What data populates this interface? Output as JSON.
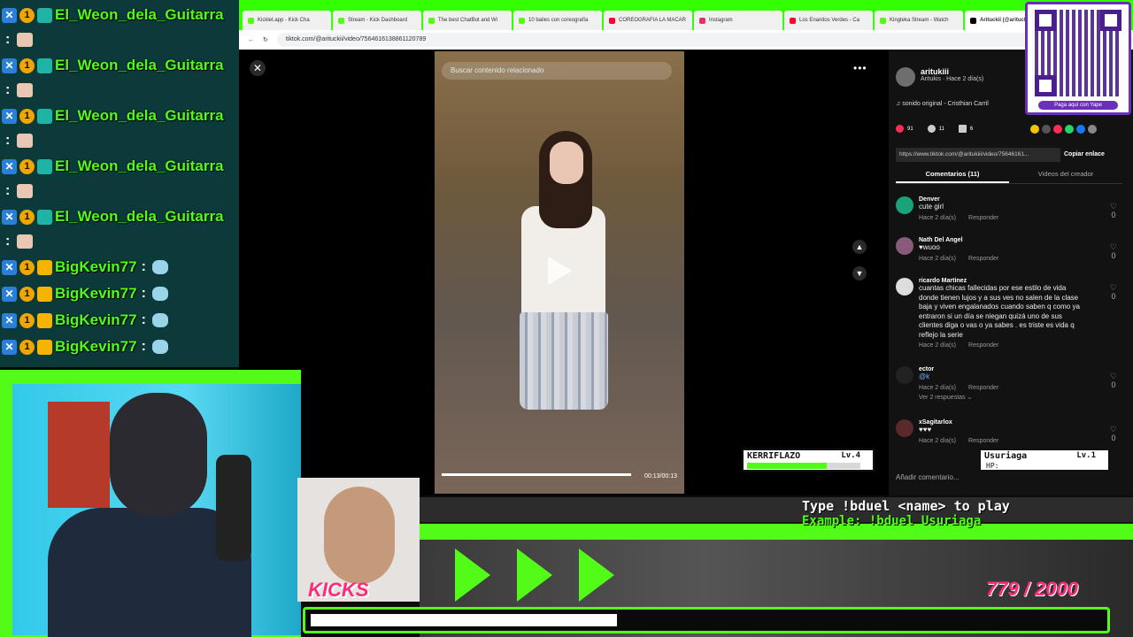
{
  "chat": {
    "messages": [
      {
        "user": "El_Weon_dela_Guitarra"
      },
      {
        "user": "El_Weon_dela_Guitarra"
      },
      {
        "user": "El_Weon_dela_Guitarra"
      },
      {
        "user": "El_Weon_dela_Guitarra"
      },
      {
        "user": "El_Weon_dela_Guitarra"
      },
      {
        "user": "BigKevin77"
      },
      {
        "user": "BigKevin77"
      },
      {
        "user": "BigKevin77"
      },
      {
        "user": "BigKevin77"
      }
    ],
    "separator": ":",
    "badge_one": "1",
    "badge_x": "✕"
  },
  "browser": {
    "tabs": [
      {
        "label": "Kicklet.app - Kick Cha"
      },
      {
        "label": "Stream - Kick Dashboard"
      },
      {
        "label": "The best ChatBot and Wi"
      },
      {
        "label": "10 bailes con coreografía"
      },
      {
        "label": "COREOGRAFIA LA MACAR"
      },
      {
        "label": "Instagram"
      },
      {
        "label": "Los Enanitos Verdes - Ca"
      },
      {
        "label": "Kingteka Stream - Watch"
      },
      {
        "label": "Arituckii (@arituckii) | T"
      }
    ],
    "url": "tiktok.com/@arituckii/video/7564616138861120789"
  },
  "tiktok": {
    "search_placeholder": "Buscar contenido relacionado",
    "video_time": "00:13/00:13",
    "video_progress": 1.0,
    "author_name": "aritukiii",
    "author_sub": "Aritukis · Hace 2 día(s)",
    "sound": "♫ sonido original - Cristhian Carril",
    "likes": "91",
    "comments_count": "11",
    "saves": "6",
    "link": "https://www.tiktok.com/@aritukiii/video/75646161...",
    "copy_label": "Copiar enlace",
    "tab_comments": "Comentarios (11)",
    "tab_creator": "Videos del creador",
    "comments": [
      {
        "user": "Denver",
        "text": "cute girl",
        "meta": "Hace 2 día(s)",
        "reply": "Responder",
        "likes": "0"
      },
      {
        "user": "Nath Del Angel",
        "text": "♥wuoo",
        "meta": "Hace 2 día(s)",
        "reply": "Responder",
        "likes": "0"
      },
      {
        "user": "ricardo Martinez",
        "text": "cuantas chicas fallecidas por ese estilo de vida donde tienen lujos y a sus ves no salen de la clase baja y viven engalanados cuando saben q como ya entraron si un día se niegan quizá uno de sus clientes diga o vas o ya sabes . es triste es vida q reflejo la serie",
        "meta": "Hace 2 día(s)",
        "reply": "Responder",
        "likes": "0"
      },
      {
        "user": "ector",
        "text": "@k",
        "meta": "Hace 2 día(s)",
        "reply": "Responder",
        "likes": "0"
      },
      {
        "user": "xSagitarlox",
        "text": "♥♥♥",
        "meta": "Hace 2 día(s)",
        "reply": "Responder",
        "likes": "0"
      }
    ],
    "view_replies": "Ver 2 respuestas ⌄",
    "add_comment": "Añadir comentario..."
  },
  "qr": {
    "label": "Paga aquí con Yape"
  },
  "overlay": {
    "kicks_label": "KICKS",
    "duel_line1": "Type !bduel <name> to play",
    "duel_line2": "Example: !bduel Usuriaga",
    "goal_count": "779 / 2000",
    "player1": {
      "name": "KERRIFLAZO",
      "level": "Lv.4",
      "hp": 0.7
    },
    "player2": {
      "name": "Usuriaga",
      "level": "Lv.1",
      "hp_label": "HP:"
    }
  },
  "colors": {
    "kick_green": "#53fc18",
    "pink": "#ff2b7a",
    "yape_purple": "#6b2fb8"
  }
}
